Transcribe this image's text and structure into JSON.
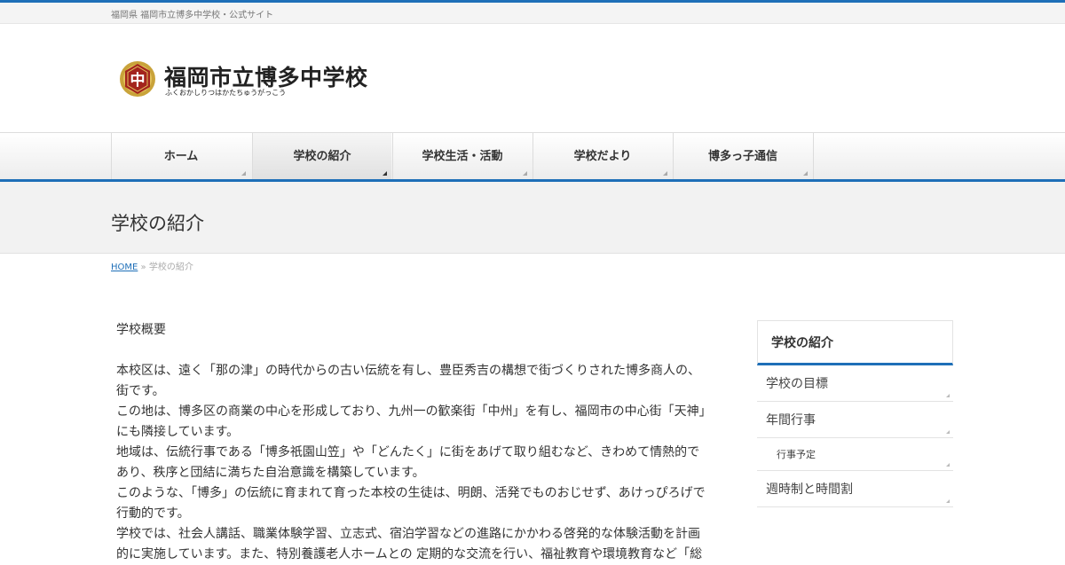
{
  "header": {
    "tagline": "福岡県 福岡市立博多中学校・公式サイト",
    "logo_title": "福岡市立博多中学校",
    "logo_subtitle": "ふくおかしりつはかたちゅうがっこう",
    "emblem_char": "中"
  },
  "nav": {
    "items": [
      {
        "label": "ホーム"
      },
      {
        "label": "学校の紹介",
        "active": true
      },
      {
        "label": "学校生活・活動"
      },
      {
        "label": "学校だより"
      },
      {
        "label": "博多っ子通信"
      }
    ]
  },
  "page": {
    "title": "学校の紹介"
  },
  "breadcrumb": {
    "home": "HOME",
    "separator": "»",
    "current": "学校の紹介"
  },
  "content": {
    "heading": "学校概要",
    "paragraphs": [
      "本校区は、遠く「那の津」の時代からの古い伝統を有し、豊臣秀吉の構想で街づくりされた博多商人の、街です。",
      "この地は、博多区の商業の中心を形成しており、九州一の歓楽街「中州」を有し、福岡市の中心街「天神」にも隣接しています。",
      "地域は、伝統行事である「博多祇園山笠」や「どんたく」に街をあげて取り組むなど、きわめて情熱的であり、秩序と団結に満ちた自治意識を構築しています。",
      "このような、「博多」の伝統に育まれて育った本校の生徒は、明朗、活発でものおじせず、あけっぴろげで行動的です。",
      "学校では、社会人講話、職業体験学習、立志式、宿泊学習などの進路にかかわる啓発的な体験活動を計画的に実施しています。また、特別養護老人ホームとの 定期的な交流を行い、福祉教育や環境教育など「総"
    ]
  },
  "sidebar": {
    "title": "学校の紹介",
    "items": [
      {
        "label": "学校の目標"
      },
      {
        "label": "年間行事"
      },
      {
        "label": "行事予定"
      },
      {
        "label": "週時制と時間割"
      }
    ]
  },
  "colors": {
    "accent": "#1e6fb8",
    "emblem_gold": "#c9a33a",
    "emblem_red": "#a3241d"
  }
}
